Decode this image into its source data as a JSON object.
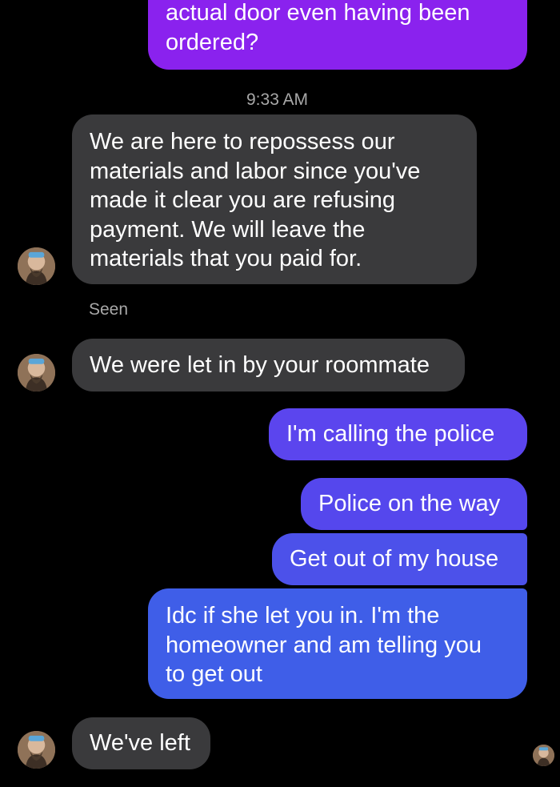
{
  "messages": {
    "m1_top": {
      "lines": [
        "actual door even having been",
        "ordered?"
      ]
    },
    "timestamp": "9:33 AM",
    "m2": {
      "lines": [
        "We are here to repossess our",
        "materials and labor since you've",
        "made it clear you are refusing",
        "payment. We will leave the",
        "materials that you paid for."
      ]
    },
    "seen": "Seen",
    "m3": {
      "text": "We were let in by your roommate"
    },
    "m4": {
      "text": "I'm calling the police"
    },
    "m5": {
      "text": "Police on the way"
    },
    "m6": {
      "text": "Get out of my house"
    },
    "m7": {
      "lines": [
        "Idc if she let you in. I'm the",
        "homeowner and am telling you",
        "to get out"
      ]
    },
    "m8": {
      "text": "We've left"
    }
  },
  "colors": {
    "background": "#000000",
    "incoming_bubble": "#3a3a3c",
    "outgoing_purple": "#8a22ee",
    "outgoing_violet": "#5b45ee",
    "outgoing_blue": "#3f5ee8",
    "meta_text": "#a8a8a8"
  },
  "icons": {
    "contact_avatar": "user-avatar-icon",
    "read_receipt": "read-receipt-avatar-icon"
  }
}
